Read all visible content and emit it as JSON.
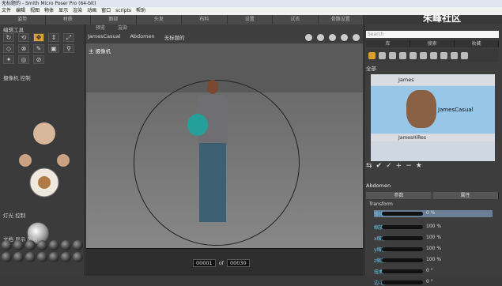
{
  "window": {
    "title": "无标题的 - Smith Micro Poser Pro  (64-bit)"
  },
  "menu": [
    "文件",
    "编辑",
    "视图",
    "物体",
    "显示",
    "渲染",
    "动画",
    "窗口",
    "scripts",
    "帮助"
  ],
  "rooms": [
    "姿势",
    "材质",
    "面部",
    "头发",
    "布料",
    "设置",
    "试衣",
    "骨骼设置"
  ],
  "watermark": "朱峰社区",
  "left_panel": {
    "editing_tools": "编辑工具",
    "camera_controls": "摄像机 控制",
    "light_controls": "灯光 控制",
    "document_style": "文档 显示 风格"
  },
  "viewport": {
    "tabs": [
      "预览",
      "渲染"
    ],
    "figure": "JamesCasual",
    "part": "Abdomen",
    "doc_title": "无标题的",
    "camera": "主 摄像机"
  },
  "timeline": {
    "frame": "00001",
    "of_label": "of",
    "total": "00030"
  },
  "library": {
    "search_placeholder": "Search",
    "tabs": [
      "库",
      "搜索",
      "收藏"
    ],
    "header": "全部",
    "items": [
      "James",
      "JamesCasual",
      "JamesHiRes"
    ]
  },
  "parameters": {
    "part": "Abdomen",
    "tabs": [
      "参数",
      "属性"
    ],
    "group": "Transform",
    "rows": [
      {
        "label": "锥化",
        "value": "0 %"
      },
      {
        "label": "缩放",
        "value": "100 %"
      },
      {
        "label": "x缩放",
        "value": "100 %"
      },
      {
        "label": "y缩放",
        "value": "100 %"
      },
      {
        "label": "z缩放",
        "value": "100 %"
      },
      {
        "label": "扭曲",
        "value": "0 °"
      },
      {
        "label": "边-边",
        "value": "0 °"
      }
    ]
  }
}
